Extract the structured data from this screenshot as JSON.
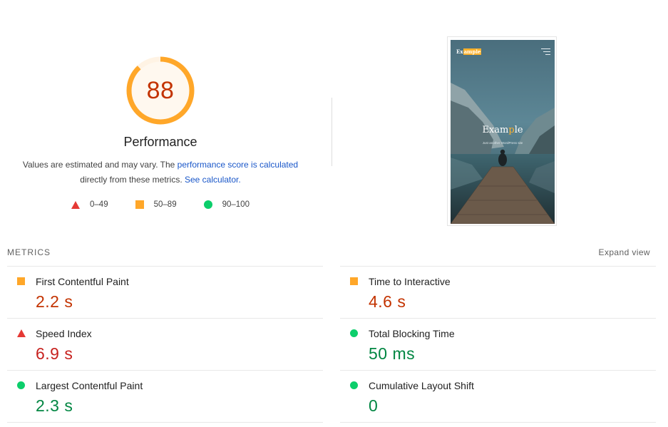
{
  "performance": {
    "score": "88",
    "score_fraction": 0.88,
    "title": "Performance",
    "desc_prefix": "Values are estimated and may vary. The ",
    "desc_link1": "performance score is calculated",
    "desc_middle": "directly from these metrics. ",
    "desc_link2": "See calculator.",
    "colors": {
      "average": "#ffa729",
      "fail": "#e53935",
      "pass": "#0cce6b",
      "score_text": "#c33300"
    }
  },
  "legend": [
    {
      "icon": "red-triangle-icon",
      "range": "0–49"
    },
    {
      "icon": "orange-square-icon",
      "range": "50–89"
    },
    {
      "icon": "green-circle-icon",
      "range": "90–100"
    }
  ],
  "thumbnail": {
    "logo_pre": "Ex",
    "logo_hl": "ample",
    "headline_pre": "Exam",
    "headline_hl": "p",
    "headline_post": "le",
    "tagline": "Just another WordPress site"
  },
  "metrics_header": "METRICS",
  "expand_view": "Expand view",
  "metrics": {
    "fcp": {
      "label": "First Contentful Paint",
      "value": "2.2 s",
      "status": "average"
    },
    "si": {
      "label": "Speed Index",
      "value": "6.9 s",
      "status": "fail"
    },
    "lcp": {
      "label": "Largest Contentful Paint",
      "value": "2.3 s",
      "status": "pass"
    },
    "tti": {
      "label": "Time to Interactive",
      "value": "4.6 s",
      "status": "average"
    },
    "tbt": {
      "label": "Total Blocking Time",
      "value": "50 ms",
      "status": "pass"
    },
    "cls": {
      "label": "Cumulative Layout Shift",
      "value": "0",
      "status": "pass"
    }
  }
}
